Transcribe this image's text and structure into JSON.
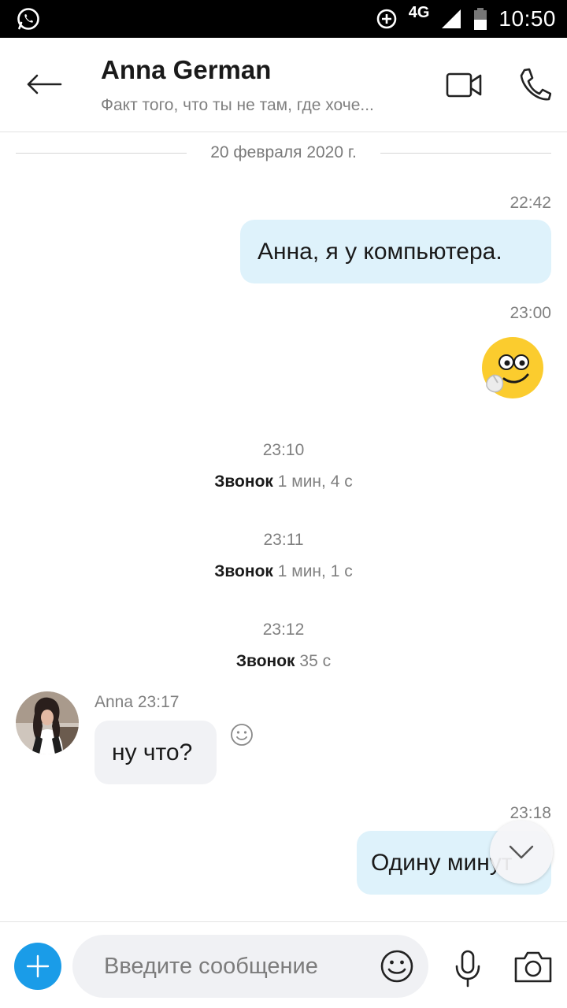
{
  "status_bar": {
    "network": "4G",
    "time": "10:50"
  },
  "header": {
    "title": "Anna German",
    "subtitle": "Факт того, что ты не там, где хоче..."
  },
  "conversation": {
    "date_separator": "20 февраля 2020 г.",
    "messages": [
      {
        "time": "22:42",
        "text": "Анна, я у компьютера."
      },
      {
        "time": "23:00"
      },
      {
        "time": "23:10",
        "label": "Звонок",
        "duration": "1 мин, 4 с"
      },
      {
        "time": "23:11",
        "label": "Звонок",
        "duration": "1 мин, 1 с"
      },
      {
        "time": "23:12",
        "label": "Звонок",
        "duration": "35 с"
      },
      {
        "sender_meta": "Anna 23:17",
        "text": "ну что?"
      },
      {
        "time": "23:18",
        "text": "Одину минут"
      }
    ]
  },
  "composer": {
    "placeholder": "Введите сообщение"
  },
  "colors": {
    "accent": "#1a9ce8",
    "outgoing_bubble": "#def2fb",
    "incoming_bubble": "#f1f2f5"
  }
}
